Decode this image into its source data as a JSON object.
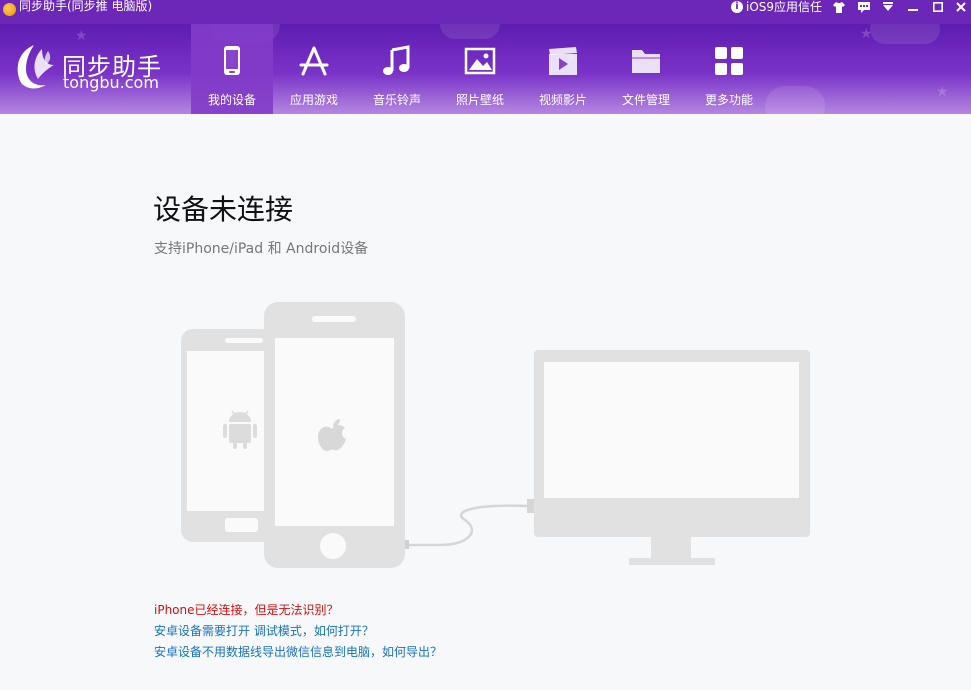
{
  "window": {
    "title": "同步助手(同步推 电脑版)",
    "trust_label": "iOS9应用信任",
    "buttons": [
      "shirt-icon",
      "chat-icon",
      "download-icon",
      "minimize-icon",
      "maximize-icon",
      "close-icon"
    ]
  },
  "logo": {
    "cn": "同步助手",
    "en": "tongbu.com"
  },
  "nav": [
    {
      "label": "我的设备",
      "icon": "phone-icon",
      "active": true
    },
    {
      "label": "应用游戏",
      "icon": "app-store-icon",
      "active": false
    },
    {
      "label": "音乐铃声",
      "icon": "music-icon",
      "active": false
    },
    {
      "label": "照片壁纸",
      "icon": "photo-icon",
      "active": false
    },
    {
      "label": "视频影片",
      "icon": "video-icon",
      "active": false
    },
    {
      "label": "文件管理",
      "icon": "folder-icon",
      "active": false
    },
    {
      "label": "更多功能",
      "icon": "grid-icon",
      "active": false
    }
  ],
  "main": {
    "title": "设备未连接",
    "subtitle": "支持iPhone/iPad 和 Android设备",
    "help": [
      {
        "text": "iPhone已经连接，但是无法识别？",
        "color": "#d01010"
      },
      {
        "text": "安卓设备需要打开 调试模式，如何打开？",
        "color": "#1a72b8"
      },
      {
        "text": "安卓设备不用数据线导出微信信息到电脑，如何导出？",
        "color": "#1a72b8"
      }
    ]
  },
  "colors": {
    "header": "#6a27b8",
    "device_gray": "#e1e1e1"
  }
}
